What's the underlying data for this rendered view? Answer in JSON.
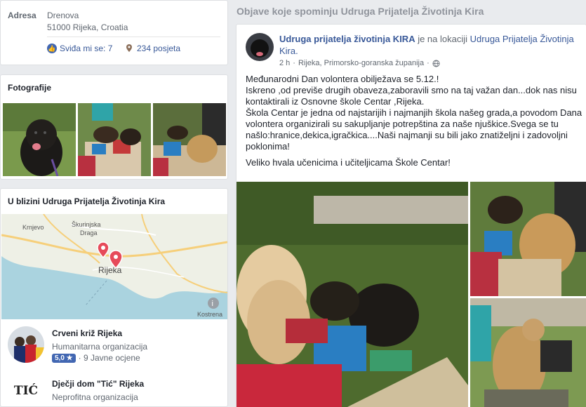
{
  "info": {
    "address_label": "Adresa",
    "address_line1": "Drenova",
    "address_line2": "51000 Rijeka, Croatia",
    "likes": "Sviđa mi se: 7",
    "visits": "234 posjeta"
  },
  "photos": {
    "title": "Fotografije"
  },
  "nearby": {
    "title": "U blizini Udruga Prijatelja Životinja Kira",
    "map_labels": [
      "Krnjevo",
      "Škurinjska",
      "Draga",
      "Rijeka",
      "Kostrena"
    ],
    "places": [
      {
        "name": "Crveni križ Rijeka",
        "category": "Humanitarna organizacija",
        "rating": "5,0 ★",
        "reviews": "· 9 Javne ocjene"
      },
      {
        "name": "Dječji dom \"Tić\" Rijeka",
        "category": "Neprofitna organizacija",
        "logo_text": "TIĆ"
      }
    ]
  },
  "posts_header": "Objave koje spominju Udruga Prijatelja Životinja Kira",
  "post": {
    "author": "Udruga prijatelja životinja KIRA",
    "connector": " je na lokaciji ",
    "location": "Udruga Prijatelja Životinja Kira.",
    "time": "2 h",
    "place": "Rijeka, Primorsko-goranska županija",
    "paragraphs": [
      "Međunarodni Dan volontera obilježava se 5.12.!",
      "Iskreno ,od previše drugih obaveza,zaboravili smo na taj važan dan...dok nas nisu kontaktirali iz Osnovne škole Centar ,Rijeka.",
      "Škola Centar je jedna od najstarijih i najmanjih škola našeg grada,a povodom Dana volontera organizirali su sakupljanje potrepština za naše njuškice.Svega se tu našlo:hranice,dekica,igračkica....Naši najmanji su bili jako znatiželjni i zadovoljni poklonima!",
      "Veliko hvala učenicima i učiteljicama Škole Centar!"
    ]
  },
  "colors": {
    "link": "#385898",
    "muted": "#606770",
    "accent": "#4267b2",
    "pin": "#e64a5a"
  }
}
